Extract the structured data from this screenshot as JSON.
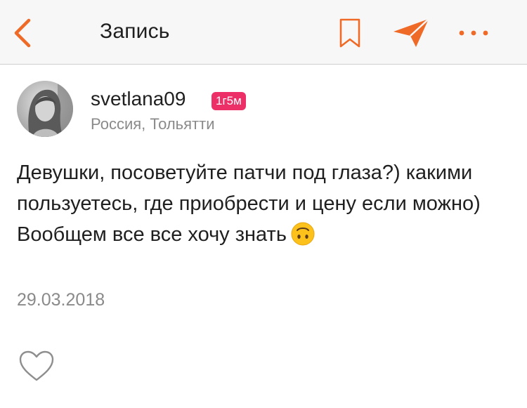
{
  "header": {
    "title": "Запись",
    "back_icon": "chevron-left-icon",
    "bookmark_icon": "bookmark-icon",
    "share_icon": "paper-plane-icon",
    "more_icon": "more-dots-icon",
    "accent_color": "#f06a27"
  },
  "author": {
    "username": "svetlana09",
    "badge": "1г5м",
    "badge_color": "#ec2f67",
    "location": "Россия, Тольятти"
  },
  "post": {
    "text": "Девушки, посоветуйте патчи под глаза?) какими пользуетесь, где приобрести и цену если можно) Вообщем все все хочу знать",
    "emoji": "upside-down-face-emoji",
    "date": "29.03.2018"
  },
  "actions": {
    "like_icon": "heart-outline-icon"
  }
}
